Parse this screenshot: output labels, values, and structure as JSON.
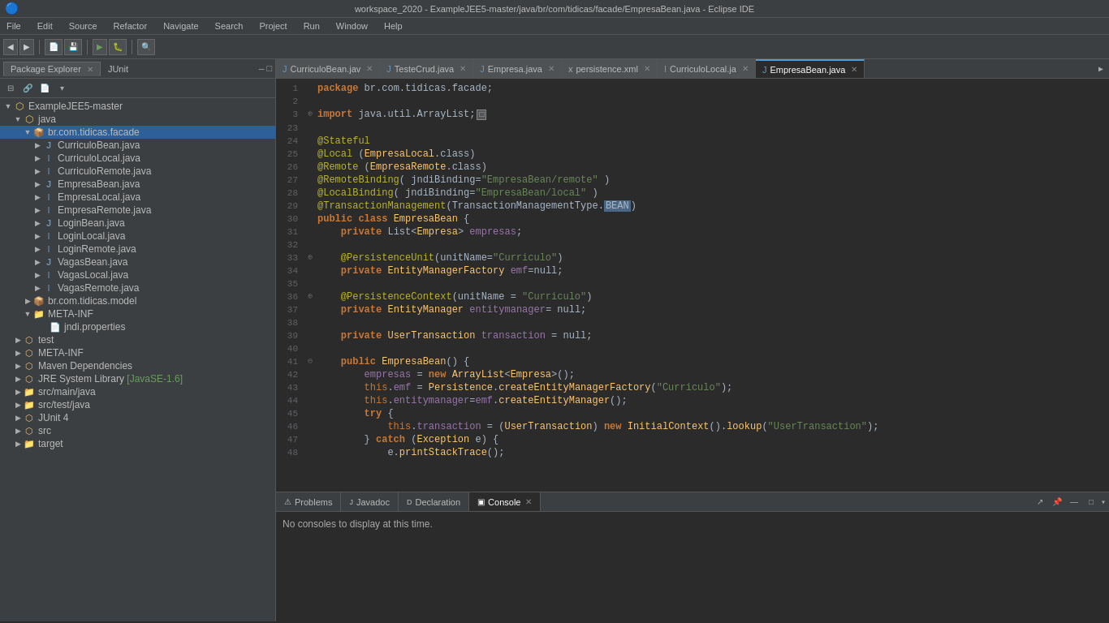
{
  "window": {
    "title": "workspace_2020 - ExampleJEE5-master/java/br/com/tidicas/facade/EmpresaBean.java - Eclipse IDE",
    "icon": "🔵"
  },
  "menubar": {
    "items": [
      "File",
      "Edit",
      "Source",
      "Refactor",
      "Navigate",
      "Search",
      "Project",
      "Run",
      "Window",
      "Help"
    ]
  },
  "panel_tabs": [
    {
      "label": "Package Explorer",
      "active": true
    },
    {
      "label": "JUnit",
      "active": false
    }
  ],
  "editor_tabs": [
    {
      "label": "CurriculoBean.jav",
      "active": false,
      "icon": "J"
    },
    {
      "label": "TesteCrud.java",
      "active": false,
      "icon": "J"
    },
    {
      "label": "Empresa.java",
      "active": false,
      "icon": "J"
    },
    {
      "label": "persistence.xml",
      "active": false,
      "icon": "x"
    },
    {
      "label": "CurriculoLocal.ja",
      "active": false,
      "icon": "J"
    },
    {
      "label": "EmpresaBean.java",
      "active": true,
      "icon": "J"
    }
  ],
  "bottom_tabs": [
    {
      "label": "Problems",
      "active": false,
      "icon": "⚠"
    },
    {
      "label": "Javadoc",
      "active": false,
      "icon": "J"
    },
    {
      "label": "Declaration",
      "active": false,
      "icon": "D"
    },
    {
      "label": "Console",
      "active": true,
      "icon": "▣"
    }
  ],
  "bottom_content": "No consoles to display at this time.",
  "tree": {
    "items": [
      {
        "label": "ExampleJEE5-master",
        "indent": 0,
        "arrow": "▼",
        "icon": "🔶",
        "type": "project"
      },
      {
        "label": "java",
        "indent": 1,
        "arrow": "▼",
        "icon": "🔶",
        "type": "src"
      },
      {
        "label": "br.com.tidicas.facade",
        "indent": 2,
        "arrow": "▼",
        "icon": "📦",
        "type": "package",
        "selected": true
      },
      {
        "label": "CurriculoBean.java",
        "indent": 3,
        "arrow": "▶",
        "icon": "J",
        "type": "class"
      },
      {
        "label": "CurriculoLocal.java",
        "indent": 3,
        "arrow": "▶",
        "icon": "I",
        "type": "interface"
      },
      {
        "label": "CurriculoRemote.java",
        "indent": 3,
        "arrow": "▶",
        "icon": "I",
        "type": "interface"
      },
      {
        "label": "EmpresaBean.java",
        "indent": 3,
        "arrow": "▶",
        "icon": "J",
        "type": "class"
      },
      {
        "label": "EmpresaLocal.java",
        "indent": 3,
        "arrow": "▶",
        "icon": "I",
        "type": "interface"
      },
      {
        "label": "EmpresaRemote.java",
        "indent": 3,
        "arrow": "▶",
        "icon": "I",
        "type": "interface"
      },
      {
        "label": "LoginBean.java",
        "indent": 3,
        "arrow": "▶",
        "icon": "J",
        "type": "class"
      },
      {
        "label": "LoginLocal.java",
        "indent": 3,
        "arrow": "▶",
        "icon": "I",
        "type": "interface"
      },
      {
        "label": "LoginRemote.java",
        "indent": 3,
        "arrow": "▶",
        "icon": "I",
        "type": "interface"
      },
      {
        "label": "VagasBean.java",
        "indent": 3,
        "arrow": "▶",
        "icon": "J",
        "type": "class"
      },
      {
        "label": "VagasLocal.java",
        "indent": 3,
        "arrow": "▶",
        "icon": "I",
        "type": "interface"
      },
      {
        "label": "VagasRemote.java",
        "indent": 3,
        "arrow": "▶",
        "icon": "I",
        "type": "interface"
      },
      {
        "label": "br.com.tidicas.model",
        "indent": 2,
        "arrow": "▶",
        "icon": "📦",
        "type": "package"
      },
      {
        "label": "META-INF",
        "indent": 2,
        "arrow": "▼",
        "icon": "📁",
        "type": "folder"
      },
      {
        "label": "jndi.properties",
        "indent": 3,
        "arrow": " ",
        "icon": "📄",
        "type": "file"
      },
      {
        "label": "test",
        "indent": 1,
        "arrow": "▶",
        "icon": "🔶",
        "type": "src"
      },
      {
        "label": "META-INF",
        "indent": 1,
        "arrow": "▶",
        "icon": "🔶",
        "type": "src"
      },
      {
        "label": "Maven Dependencies",
        "indent": 1,
        "arrow": "▶",
        "icon": "🔶",
        "type": "src"
      },
      {
        "label": "JRE System Library [JavaSE-1.6]",
        "indent": 1,
        "arrow": "▶",
        "icon": "🔶",
        "type": "src"
      },
      {
        "label": "src/main/java",
        "indent": 1,
        "arrow": "▶",
        "icon": "📁",
        "type": "folder"
      },
      {
        "label": "src/test/java",
        "indent": 1,
        "arrow": "▶",
        "icon": "📁",
        "type": "folder"
      },
      {
        "label": "JUnit 4",
        "indent": 1,
        "arrow": "▶",
        "icon": "🔶",
        "type": "src"
      },
      {
        "label": "src",
        "indent": 1,
        "arrow": "▶",
        "icon": "🔶",
        "type": "src"
      },
      {
        "label": "target",
        "indent": 1,
        "arrow": "▶",
        "icon": "📁",
        "type": "folder"
      }
    ]
  },
  "code": {
    "lines": [
      {
        "num": 1,
        "fold": " ",
        "content": "package br.com.tidicas.facade;"
      },
      {
        "num": 2,
        "fold": " ",
        "content": ""
      },
      {
        "num": 3,
        "fold": "⊕",
        "content": "import java.util.ArrayList;"
      },
      {
        "num": 23,
        "fold": " ",
        "content": ""
      },
      {
        "num": 24,
        "fold": " ",
        "content": "@Stateful"
      },
      {
        "num": 25,
        "fold": " ",
        "content": "@Local (EmpresaLocal.class)"
      },
      {
        "num": 26,
        "fold": " ",
        "content": "@Remote (EmpresaRemote.class)"
      },
      {
        "num": 27,
        "fold": " ",
        "content": "@RemoteBinding( jndiBinding=\"EmpresaBean/remote\" )"
      },
      {
        "num": 28,
        "fold": " ",
        "content": "@LocalBinding( jndiBinding=\"EmpresaBean/local\" )"
      },
      {
        "num": 29,
        "fold": " ",
        "content": "@TransactionManagement(TransactionManagementType.BEAN)"
      },
      {
        "num": 30,
        "fold": " ",
        "content": "public class EmpresaBean {"
      },
      {
        "num": 31,
        "fold": " ",
        "content": "    private List<Empresa> empresas;"
      },
      {
        "num": 32,
        "fold": " ",
        "content": ""
      },
      {
        "num": 33,
        "fold": "⊕",
        "content": "    @PersistenceUnit(unitName=\"Curriculo\")"
      },
      {
        "num": 34,
        "fold": " ",
        "content": "    private EntityManagerFactory emf=null;"
      },
      {
        "num": 35,
        "fold": " ",
        "content": ""
      },
      {
        "num": 36,
        "fold": "⊕",
        "content": "    @PersistenceContext(unitName = \"Curriculo\")"
      },
      {
        "num": 37,
        "fold": " ",
        "content": "    private EntityManager entitymanager= null;"
      },
      {
        "num": 38,
        "fold": " ",
        "content": ""
      },
      {
        "num": 39,
        "fold": " ",
        "content": "    private UserTransaction transaction = null;"
      },
      {
        "num": 40,
        "fold": " ",
        "content": ""
      },
      {
        "num": 41,
        "fold": "⊖",
        "content": "    public EmpresaBean() {"
      },
      {
        "num": 42,
        "fold": " ",
        "content": "        empresas = new ArrayList<Empresa>();"
      },
      {
        "num": 43,
        "fold": " ",
        "content": "        this.emf = Persistence.createEntityManagerFactory(\"Curriculo\");"
      },
      {
        "num": 44,
        "fold": " ",
        "content": "        this.entitymanager=emf.createEntityManager();"
      },
      {
        "num": 45,
        "fold": " ",
        "content": "        try {"
      },
      {
        "num": 46,
        "fold": " ",
        "content": "            this.transaction = (UserTransaction) new InitialContext().lookup(\"UserTransaction\");"
      },
      {
        "num": 47,
        "fold": " ",
        "content": "        } catch (Exception e) {"
      },
      {
        "num": 48,
        "fold": " ",
        "content": "            e.printStackTrace();"
      }
    ]
  }
}
